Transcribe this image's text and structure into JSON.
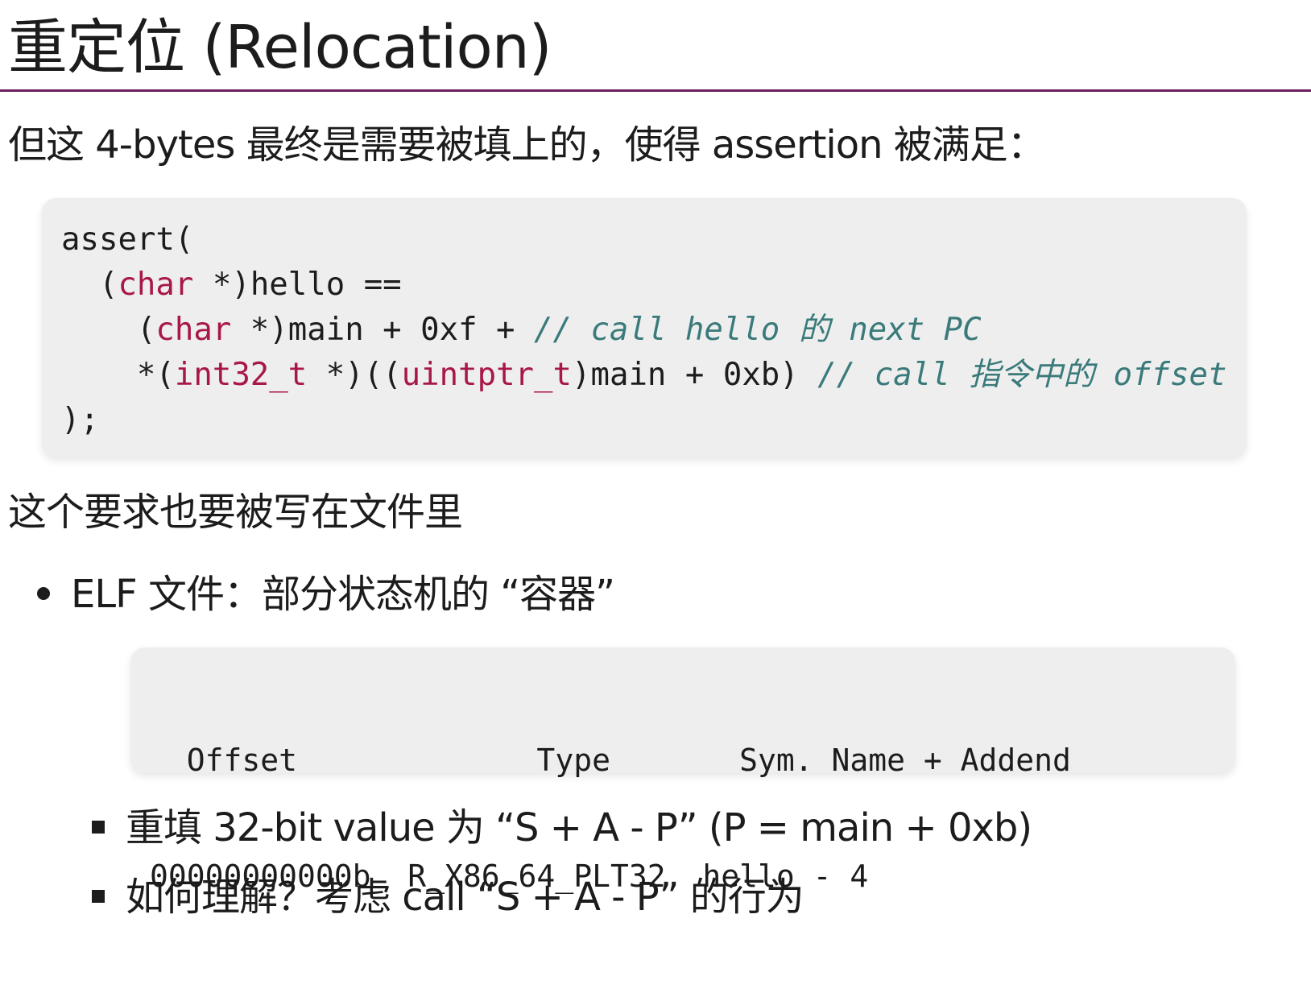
{
  "title": "重定位 (Relocation)",
  "intro": "但这 4-bytes 最终是需要被填上的，使得 assertion 被满足：",
  "code1": {
    "line1": "assert(",
    "line2_open": "(",
    "line2_type": "char",
    "line2_rest": " *)hello ==",
    "line3_open": "(",
    "line3_type": "char",
    "line3_rest": " *)main + 0xf + ",
    "line3_comment": "// call hello 的 next PC",
    "line4_a": "*(",
    "line4_type1": "int32_t",
    "line4_b": " *)((",
    "line4_type2": "uintptr_t",
    "line4_c": ")main + 0xb) ",
    "line4_comment": "// call 指令中的 offset",
    "line5": ");"
  },
  "para2": "这个要求也要被写在文件里",
  "bullet1": "ELF 文件：部分状态机的 “容器”",
  "reloc_table": {
    "header": "  Offset             Type       Sym. Name + Addend",
    "row": "00000000000b  R_X86_64_PLT32  hello - 4"
  },
  "sub_bullets": [
    "重填 32-bit value 为 “S + A - P” (P = main + 0xb)",
    "如何理解？考虑 call “S + A - P” 的行为"
  ],
  "colors": {
    "title_rule": "#6b1f5f",
    "keyword": "#a8174a",
    "comment": "#3a7a7a",
    "code_bg": "#eeeeee"
  }
}
